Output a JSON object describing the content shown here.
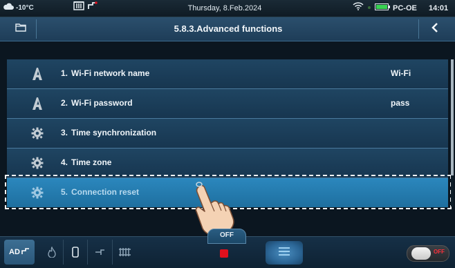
{
  "status_bar": {
    "temperature": "-10°C",
    "date": "Thursday, 8.Feb.2024",
    "device_name": "PC-OE",
    "time": "14:01"
  },
  "header": {
    "title": "5.8.3.Advanced functions"
  },
  "menu": {
    "items": [
      {
        "number": "1.",
        "label": "Wi-Fi network name",
        "value": "Wi-Fi",
        "icon": "letter-a-icon"
      },
      {
        "number": "2.",
        "label": "Wi-Fi password",
        "value": "pass",
        "icon": "letter-a-icon"
      },
      {
        "number": "3.",
        "label": "Time synchronization",
        "value": "",
        "icon": "gear-icon"
      },
      {
        "number": "4.",
        "label": "Time zone",
        "value": "",
        "icon": "gear-icon"
      },
      {
        "number": "5.",
        "label": "Connection reset",
        "value": "",
        "icon": "gear-icon",
        "selected": true
      }
    ]
  },
  "bottom_bar": {
    "mode_label": "AD",
    "state_tab": "OFF",
    "toggle_label": "OFF"
  },
  "colors": {
    "row_bg": "#1f4562",
    "selected_bg": "#2b87bd",
    "stop_red": "#e0101d",
    "accent_green": "#39d353"
  }
}
